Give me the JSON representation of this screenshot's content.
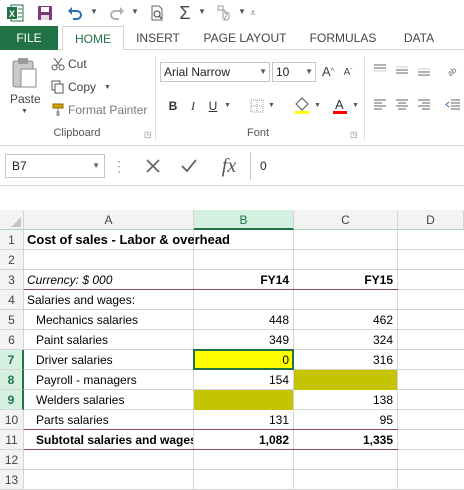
{
  "qat": {
    "icons": [
      "excel-logo-icon",
      "save-icon",
      "undo-icon",
      "redo-icon",
      "print-preview-icon",
      "autosum-icon",
      "touch-mode-icon",
      "customize-qat-icon"
    ]
  },
  "tabs": [
    {
      "label": "FILE",
      "active": false
    },
    {
      "label": "HOME",
      "active": true
    },
    {
      "label": "INSERT",
      "active": false
    },
    {
      "label": "PAGE LAYOUT",
      "active": false
    },
    {
      "label": "FORMULAS",
      "active": false
    },
    {
      "label": "DATA",
      "active": false
    }
  ],
  "ribbon": {
    "clipboard": {
      "paste_label": "Paste",
      "cut_label": "Cut",
      "copy_label": "Copy",
      "format_painter_label": "Format Painter",
      "group_label": "Clipboard"
    },
    "font": {
      "font_name": "Arial Narrow",
      "font_size": "10",
      "bold": "B",
      "italic": "I",
      "underline": "U",
      "group_label": "Font"
    }
  },
  "formula_bar": {
    "name_box": "B7",
    "fx_label": "fx",
    "value": "0"
  },
  "sheet": {
    "columns": [
      "A",
      "B",
      "C",
      "D"
    ],
    "selected_column": "B",
    "selected_rows": [
      "7",
      "8",
      "9"
    ],
    "rows": [
      {
        "n": "1",
        "a": "Cost of sales - Labor & overhead",
        "b": "",
        "c": ""
      },
      {
        "n": "2",
        "a": "",
        "b": "",
        "c": ""
      },
      {
        "n": "3",
        "a": "Currency: $ 000",
        "b": "FY14",
        "c": "FY15"
      },
      {
        "n": "4",
        "a": "Salaries and wages:",
        "b": "",
        "c": ""
      },
      {
        "n": "5",
        "a": "Mechanics salaries",
        "b": "448",
        "c": "462"
      },
      {
        "n": "6",
        "a": "Paint salaries",
        "b": "349",
        "c": "324"
      },
      {
        "n": "7",
        "a": "Driver salaries",
        "b": "0",
        "c": "316"
      },
      {
        "n": "8",
        "a": "Payroll - managers",
        "b": "154",
        "c": ""
      },
      {
        "n": "9",
        "a": "Welders salaries",
        "b": "",
        "c": "138"
      },
      {
        "n": "10",
        "a": "Parts salaries",
        "b": "131",
        "c": "95"
      },
      {
        "n": "11",
        "a": "Subtotal salaries and wages",
        "b": "1,082",
        "c": "1,335"
      },
      {
        "n": "12",
        "a": "",
        "b": "",
        "c": ""
      },
      {
        "n": "13",
        "a": "",
        "b": "",
        "c": ""
      }
    ]
  },
  "colors": {
    "excel_green": "#217346",
    "highlight_yellow": "#ffff00",
    "highlight_olive": "#c4c400",
    "border_maroon": "#8c4a6a"
  }
}
